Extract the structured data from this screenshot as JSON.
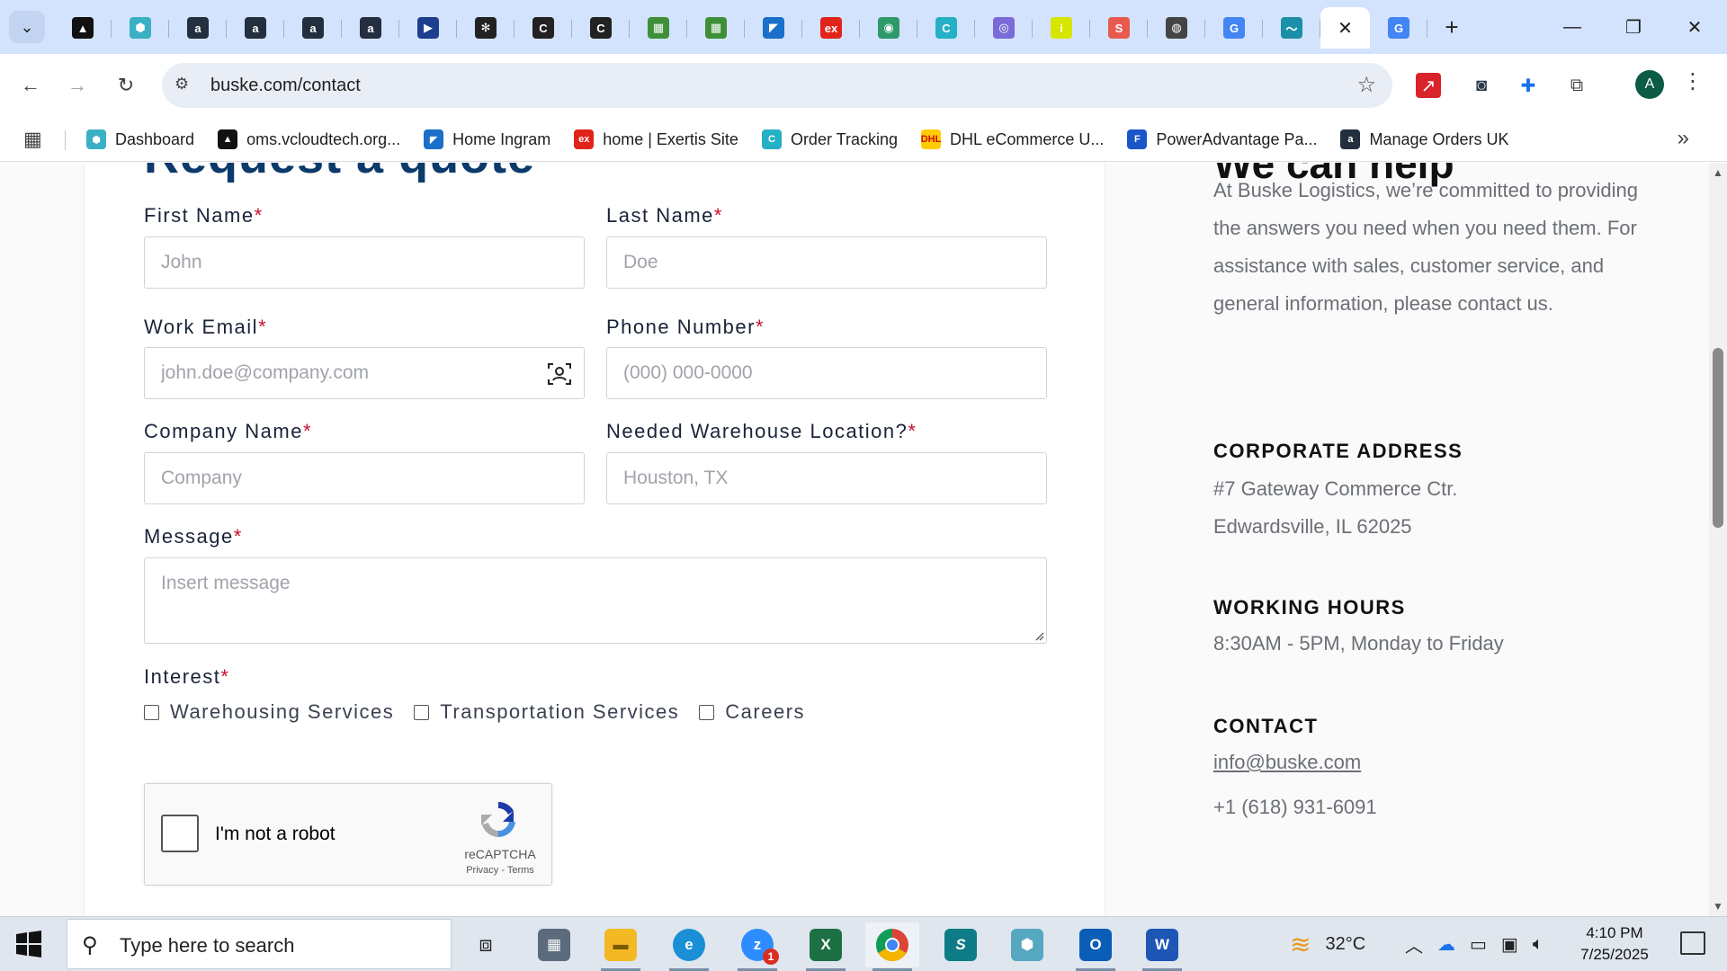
{
  "browser": {
    "tabs": [
      {
        "icon": "vcloud-triangle-icon",
        "color": "#111111",
        "glyph": "▲"
      },
      {
        "icon": "hexagon-dashboard-icon",
        "color": "#3ab0c4",
        "glyph": "⬢"
      },
      {
        "icon": "amazon-icon",
        "color": "#232f3e",
        "glyph": "a"
      },
      {
        "icon": "amazon-icon",
        "color": "#232f3e",
        "glyph": "a"
      },
      {
        "icon": "amazon-icon",
        "color": "#232f3e",
        "glyph": "a"
      },
      {
        "icon": "amazon-icon",
        "color": "#232f3e",
        "glyph": "a"
      },
      {
        "icon": "play-arrow-icon",
        "color": "#1d3f8f",
        "glyph": "▶"
      },
      {
        "icon": "openai-icon",
        "color": "#222222",
        "glyph": "✻"
      },
      {
        "icon": "c-logo-icon",
        "color": "#222222",
        "glyph": "C"
      },
      {
        "icon": "c-logo-icon",
        "color": "#222222",
        "glyph": "C"
      },
      {
        "icon": "green-cart-icon",
        "color": "#3f8f3a",
        "glyph": "▦"
      },
      {
        "icon": "green-cart-icon",
        "color": "#3f8f3a",
        "glyph": "▦"
      },
      {
        "icon": "ingram-icon",
        "color": "#1a6fc9",
        "glyph": "◤"
      },
      {
        "icon": "exertis-icon",
        "color": "#e2231a",
        "glyph": "ex"
      },
      {
        "icon": "leaf-icon",
        "color": "#2e9a6a",
        "glyph": "◉"
      },
      {
        "icon": "order-tracking-icon",
        "color": "#25b0c6",
        "glyph": "C"
      },
      {
        "icon": "chart-circle-icon",
        "color": "#7a6bd6",
        "glyph": "◎"
      },
      {
        "icon": "infos-icon",
        "color": "#d7e600",
        "glyph": "i"
      },
      {
        "icon": "sheet-icon",
        "color": "#e85a4f",
        "glyph": "S"
      },
      {
        "icon": "chrome-icon",
        "color": "#444444",
        "glyph": "◍"
      },
      {
        "icon": "google-icon",
        "color": "#4285f4",
        "glyph": "G"
      },
      {
        "icon": "bird-icon",
        "color": "#1b8fa8",
        "glyph": "〜"
      },
      {
        "icon": "close-icon",
        "active": true
      },
      {
        "icon": "google-icon",
        "color": "#4285f4",
        "glyph": "G"
      }
    ],
    "new_tab": "+",
    "url": "buske.com/contact",
    "avatar_letter": "A",
    "bookmarks": [
      {
        "label": "Dashboard",
        "icon": "hexagon-dashboard-icon",
        "color": "#3ab0c4",
        "glyph": "⬢"
      },
      {
        "label": "oms.vcloudtech.org...",
        "icon": "vcloud-triangle-icon",
        "color": "#111111",
        "glyph": "▲"
      },
      {
        "label": "Home Ingram",
        "icon": "ingram-icon",
        "color": "#1a6fc9",
        "glyph": "◤"
      },
      {
        "label": "home | Exertis Site",
        "icon": "exertis-icon",
        "color": "#e2231a",
        "glyph": "ex"
      },
      {
        "label": "Order Tracking",
        "icon": "order-tracking-icon",
        "color": "#25b0c6",
        "glyph": "C"
      },
      {
        "label": "DHL eCommerce U...",
        "icon": "dhl-icon",
        "color": "#ffcc00",
        "glyph": "DHL"
      },
      {
        "label": "PowerAdvantage Pa...",
        "icon": "document-icon",
        "color": "#1a56c9",
        "glyph": "F"
      },
      {
        "label": "Manage Orders UK",
        "icon": "amazon-icon",
        "color": "#232f3e",
        "glyph": "a"
      }
    ]
  },
  "form": {
    "heading": "Request a quote",
    "first_name": {
      "label": "First Name",
      "placeholder": "John"
    },
    "last_name": {
      "label": "Last Name",
      "placeholder": "Doe"
    },
    "work_email": {
      "label": "Work Email",
      "placeholder": "john.doe@company.com"
    },
    "phone": {
      "label": "Phone Number",
      "placeholder": "(000) 000-0000"
    },
    "company": {
      "label": "Company Name",
      "placeholder": "Company"
    },
    "warehouse": {
      "label": "Needed Warehouse Location?",
      "placeholder": "Houston, TX"
    },
    "message": {
      "label": "Message",
      "placeholder": "Insert message"
    },
    "interest": {
      "label": "Interest",
      "options": [
        "Warehousing Services",
        "Transportation Services",
        "Careers"
      ]
    },
    "required_mark": "*",
    "captcha": {
      "text": "I'm not a robot",
      "brand": "reCAPTCHA",
      "links": "Privacy - Terms"
    }
  },
  "info": {
    "heading": "We can help",
    "intro": "At Buske Logistics, we’re committed to providing the answers you need when you need them. For assistance with sales, customer service, and general information, please contact us.",
    "address_heading": "CORPORATE ADDRESS",
    "address_line1": "#7 Gateway Commerce Ctr.",
    "address_line2": "Edwardsville, IL 62025",
    "hours_heading": "WORKING HOURS",
    "hours": "8:30AM - 5PM, Monday to Friday",
    "contact_heading": "CONTACT",
    "email": "info@buske.com",
    "phone": "+1 (618) 931-6091"
  },
  "taskbar": {
    "search_placeholder": "Type here to search",
    "weather": "32°C",
    "time": "4:10 PM",
    "date": "7/25/2025",
    "zoom_badge": "1"
  }
}
